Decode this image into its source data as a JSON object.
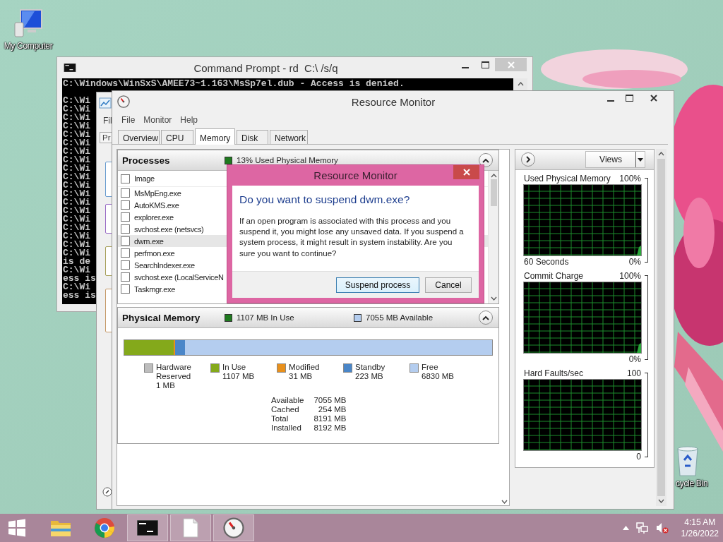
{
  "desktop_icons": [
    {
      "kind": "computer",
      "label": "My Computer"
    },
    {
      "kind": "recycle_bin",
      "label": "cycle Bin"
    }
  ],
  "command_prompt": {
    "title": "Command Prompt - rd  C:\\ /s/q",
    "lines": [
      "C:\\Windows\\WinSxS\\AMEE73~1.163\\MsSp7el.dub - Access is denied.",
      "C:\\Wi",
      "C:\\Wi",
      "C:\\Wi",
      "C:\\Wi",
      "C:\\Wi",
      "C:\\Wi",
      "C:\\Wi",
      "C:\\Wi",
      "C:\\Wi",
      "C:\\Wi",
      "C:\\Wi",
      "C:\\Wi",
      "C:\\Wi",
      "C:\\Wi",
      "C:\\Wi",
      "C:\\Wi",
      "C:\\Wi",
      "C:\\Wi",
      "C:\\Wi",
      "is de",
      "C:\\Wi",
      "ess is",
      "C:\\Wi",
      "ess is"
    ]
  },
  "background_window": {
    "menu": "Fil",
    "tab": "Pr"
  },
  "resource_monitor": {
    "title": "Resource Monitor",
    "menu": [
      "File",
      "Monitor",
      "Help"
    ],
    "tabs": [
      {
        "label": "Overview",
        "selected": false
      },
      {
        "label": "CPU",
        "selected": false
      },
      {
        "label": "Memory",
        "selected": true
      },
      {
        "label": "Disk",
        "selected": false
      },
      {
        "label": "Network",
        "selected": false
      }
    ],
    "processes": {
      "title": "Processes",
      "summary": "13% Used Physical Memory",
      "column": {
        "label": "Image",
        "checked": false
      },
      "rows": [
        {
          "name": "MsMpEng.exe",
          "checked": false,
          "selected": false
        },
        {
          "name": "AutoKMS.exe",
          "checked": false,
          "selected": false
        },
        {
          "name": "explorer.exe",
          "checked": false,
          "selected": false
        },
        {
          "name": "svchost.exe (netsvcs)",
          "checked": false,
          "selected": false
        },
        {
          "name": "dwm.exe",
          "checked": false,
          "selected": true
        },
        {
          "name": "perfmon.exe",
          "checked": false,
          "selected": false
        },
        {
          "name": "SearchIndexer.exe",
          "checked": false,
          "selected": false
        },
        {
          "name": "svchost.exe (LocalServiceN",
          "checked": false,
          "selected": false
        },
        {
          "name": "Taskmgr.exe",
          "checked": false,
          "selected": false
        }
      ]
    },
    "physical_memory": {
      "title": "Physical Memory",
      "in_use": "1107 MB In Use",
      "available": "7055 MB Available",
      "bar": [
        {
          "color": "#84a91b",
          "level": 0.135
        },
        {
          "color": "#e8901c",
          "level": 0.004
        },
        {
          "color": "#4a86c8",
          "level": 0.027
        },
        {
          "color": "#b4cdef",
          "level": 0.834
        }
      ],
      "legend": [
        {
          "label": "Hardware Reserved",
          "value": "1 MB",
          "color": "#bdbdbd"
        },
        {
          "label": "In Use",
          "value": "1107 MB",
          "color": "#84a91b"
        },
        {
          "label": "Modified",
          "value": "31 MB",
          "color": "#e8901c"
        },
        {
          "label": "Standby",
          "value": "223 MB",
          "color": "#4a86c8"
        },
        {
          "label": "Free",
          "value": "6830 MB",
          "color": "#b4cdef"
        }
      ],
      "stats": [
        {
          "label": "Available",
          "value": "7055 MB"
        },
        {
          "label": "Cached",
          "value": "254 MB"
        },
        {
          "label": "Total",
          "value": "8191 MB"
        },
        {
          "label": "Installed",
          "value": "8192 MB"
        }
      ]
    },
    "side_panel": {
      "views": "Views",
      "graphs": [
        {
          "title": "Used Physical Memory",
          "max": "100%",
          "footer_left": "60 Seconds",
          "min": "0%"
        },
        {
          "title": "Commit Charge",
          "max": "100%",
          "min": "0%"
        },
        {
          "title": "Hard Faults/sec",
          "max": "100",
          "min": "0"
        }
      ]
    }
  },
  "dialog": {
    "title": "Resource Monitor",
    "heading": "Do you want to suspend dwm.exe?",
    "message": "If an open program is associated with this process and you suspend it, you might lose any unsaved data. If you suspend a system process, it might result in system instability. Are you sure you want to continue?",
    "buttons": [
      {
        "label": "Suspend process",
        "focused": true
      },
      {
        "label": "Cancel",
        "focused": false
      }
    ]
  },
  "taskbar": {
    "items": [
      {
        "kind": "start",
        "active": false
      },
      {
        "kind": "explorer",
        "active": false
      },
      {
        "kind": "browser",
        "active": false
      },
      {
        "kind": "terminal",
        "active": true
      },
      {
        "kind": "document",
        "active": true
      },
      {
        "kind": "gauge",
        "active": true
      }
    ],
    "time": "4:15 AM",
    "date": "1/26/2022"
  }
}
